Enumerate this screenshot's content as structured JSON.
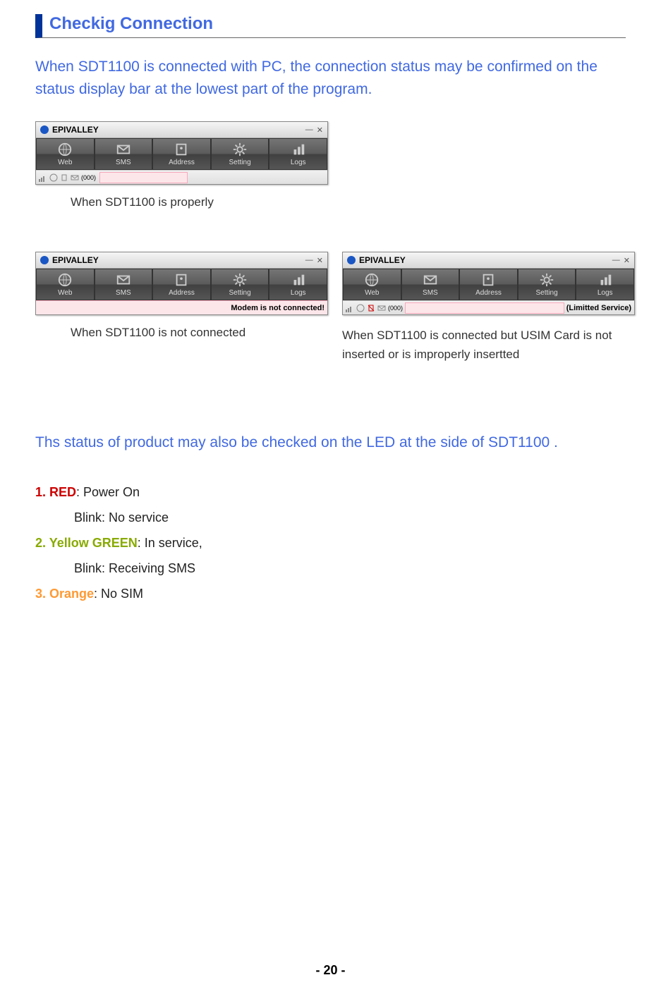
{
  "section_title": "Checkig Connection",
  "intro_text": "When SDT1100 is connected with PC, the connection status may be confirmed on the status display bar at the lowest part of the program.",
  "app": {
    "title": "EPIVALLEY",
    "toolbar": {
      "web": "Web",
      "sms": "SMS",
      "address": "Address",
      "setting": "Setting",
      "logs": "Logs"
    },
    "status": {
      "count": "(000)",
      "not_connected": "Modem is not connected!",
      "limited": "(Limitted Service)"
    }
  },
  "captions": {
    "connected": "When SDT1100 is properly",
    "not_connected": "When SDT1100 is not connected",
    "limited": "When  SDT1100  is  connected  but  USIM Card is not inserted or is improperly insertted"
  },
  "led_intro": "Ths status of product may also be checked on the LED at the side of SDT1100 .",
  "led": {
    "red_label": "1. RED",
    "red_desc": ": Power On",
    "red_blink": "Blink: No service",
    "green_label": "2. Yellow GREEN",
    "green_desc": ": In service,",
    "green_blink": "Blink: Receiving SMS",
    "orange_label": "3. Orange",
    "orange_desc": ": No SIM"
  },
  "page_number": "- 20 -"
}
